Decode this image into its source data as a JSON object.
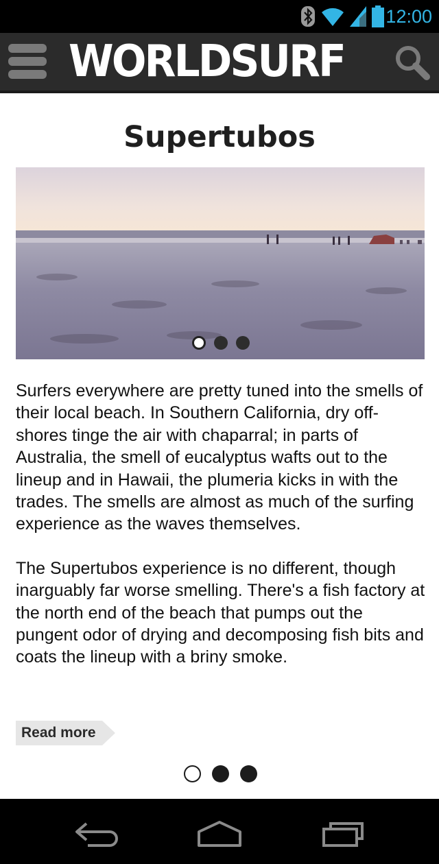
{
  "status_bar": {
    "time": "12:00",
    "icons": [
      "bluetooth-icon",
      "wifi-icon",
      "signal-icon",
      "battery-icon"
    ],
    "accent_color": "#33b5e5"
  },
  "header": {
    "logo_text": "WORLDSURF",
    "menu_icon": "hamburger-menu-icon",
    "search_icon": "search-icon",
    "background": "#2b2b2b"
  },
  "article": {
    "title": "Supertubos",
    "carousel": {
      "slides": 3,
      "active_index": 0
    },
    "paragraphs": [
      "Surfers everywhere are pretty tuned into the smells of their local beach. In Southern California, dry off-shores tinge the air with chaparral; in parts of Australia, the smell of eucalyptus wafts out to the lineup and in Hawaii, the plumeria kicks in with the trades. The smells are almost as much of the surfing experience as the waves themselves.",
      "The Supertubos experience is no different, though inarguably far worse smelling. There's a fish factory at the north end of the beach that pumps out the pungent odor of drying and decomposing fish bits and coats the lineup with a briny smoke."
    ],
    "read_more_label": "Read more"
  },
  "pager": {
    "pages": 3,
    "active_index": 0
  },
  "nav_bar": {
    "icons": [
      "back-icon",
      "home-icon",
      "recent-apps-icon"
    ]
  }
}
